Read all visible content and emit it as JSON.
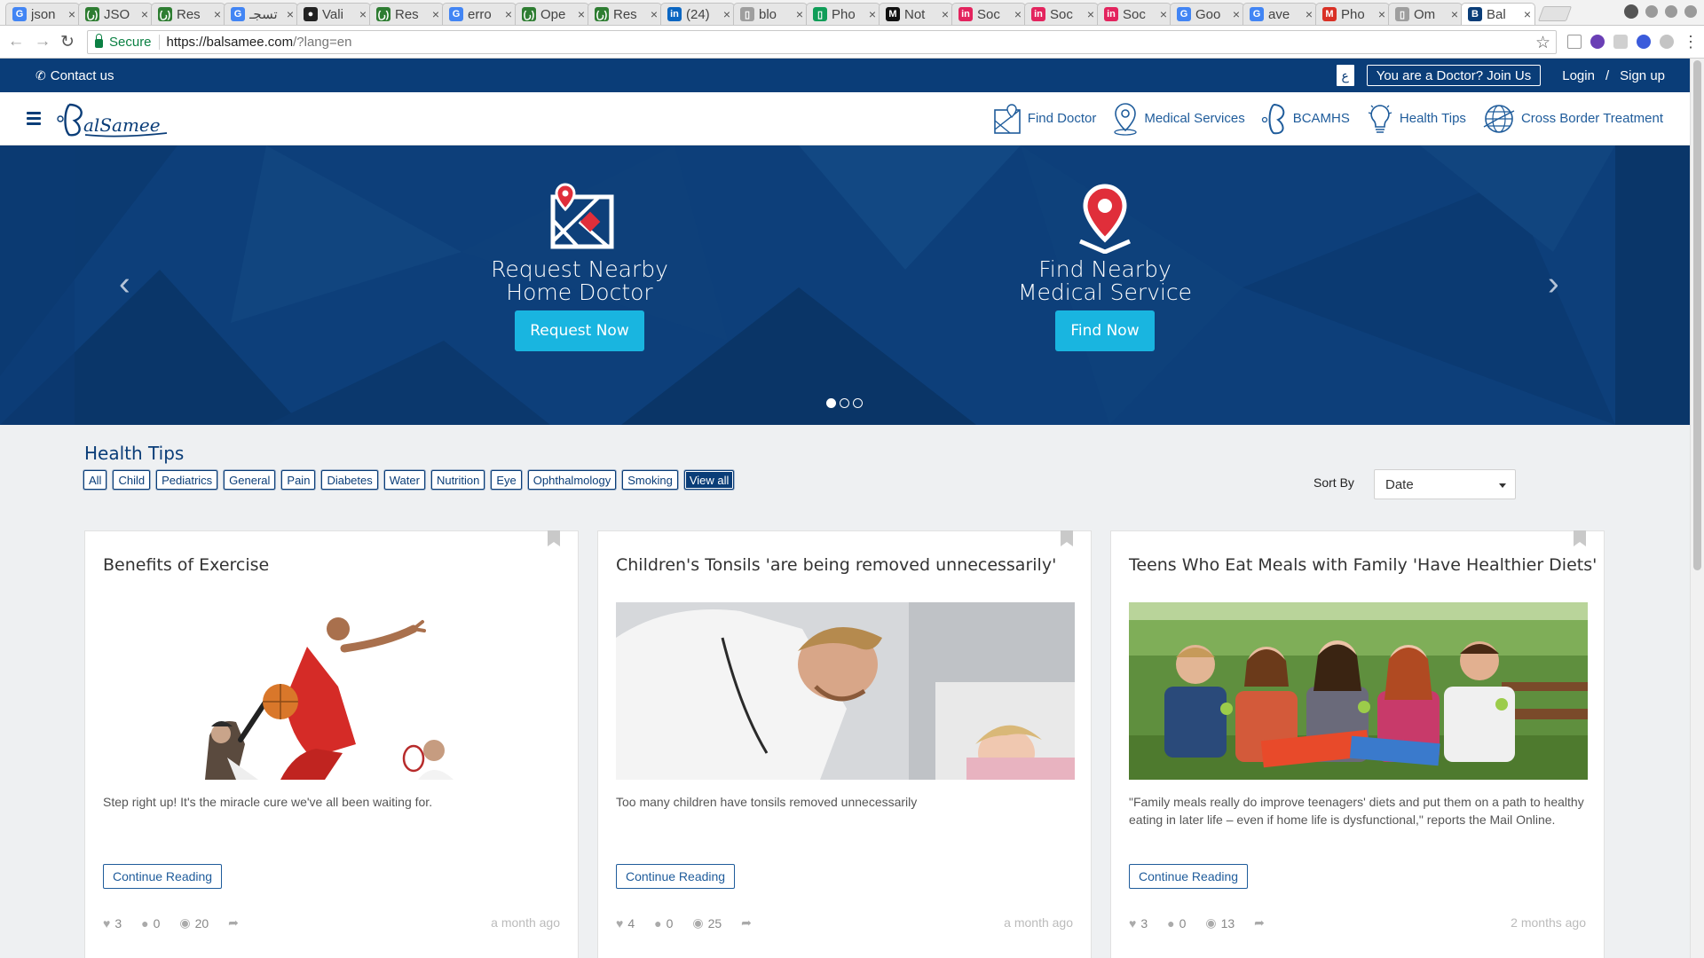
{
  "browser": {
    "tabs": [
      {
        "label": "json",
        "icon": "google-icon",
        "color": "#4285f4",
        "glyph": "G"
      },
      {
        "label": "JSO",
        "icon": "arabic-site-icon",
        "color": "#2e7d32",
        "glyph": "(ر)"
      },
      {
        "label": "Res",
        "icon": "arabic-site-icon",
        "color": "#2e7d32",
        "glyph": "(ر)"
      },
      {
        "label": "تسجـ",
        "icon": "google-icon",
        "color": "#4285f4",
        "glyph": "G"
      },
      {
        "label": "Vali",
        "icon": "github-icon",
        "color": "#222222",
        "glyph": "●"
      },
      {
        "label": "Res",
        "icon": "arabic-site-icon",
        "color": "#2e7d32",
        "glyph": "(ر)"
      },
      {
        "label": "erro",
        "icon": "google-icon",
        "color": "#4285f4",
        "glyph": "G"
      },
      {
        "label": "Ope",
        "icon": "arabic-site-icon",
        "color": "#2e7d32",
        "glyph": "(ر)"
      },
      {
        "label": "Res",
        "icon": "arabic-site-icon",
        "color": "#2e7d32",
        "glyph": "(ر)"
      },
      {
        "label": "(24)",
        "icon": "linkedin-icon",
        "color": "#0a66c2",
        "glyph": "in"
      },
      {
        "label": "blo",
        "icon": "document-icon",
        "color": "#9e9e9e",
        "glyph": "▯"
      },
      {
        "label": "Pho",
        "icon": "sheet-icon",
        "color": "#0f9d58",
        "glyph": "▯"
      },
      {
        "label": "Not",
        "icon": "medium-icon",
        "color": "#111111",
        "glyph": "M"
      },
      {
        "label": "Soc",
        "icon": "invision-icon",
        "color": "#e3245e",
        "glyph": "in"
      },
      {
        "label": "Soc",
        "icon": "invision-icon",
        "color": "#e3245e",
        "glyph": "in"
      },
      {
        "label": "Soc",
        "icon": "invision-icon",
        "color": "#e3245e",
        "glyph": "in"
      },
      {
        "label": "Goo",
        "icon": "translate-icon",
        "color": "#4285f4",
        "glyph": "G"
      },
      {
        "label": "ave",
        "icon": "google-icon",
        "color": "#4285f4",
        "glyph": "G"
      },
      {
        "label": "Pho",
        "icon": "gmail-icon",
        "color": "#d93025",
        "glyph": "M"
      },
      {
        "label": "Om",
        "icon": "document-icon",
        "color": "#9e9e9e",
        "glyph": "▯"
      },
      {
        "label": "Bal",
        "icon": "balsamee-icon",
        "color": "#0a3d78",
        "glyph": "B",
        "active": true
      }
    ],
    "secure_label": "Secure",
    "url_host": "https://balsamee.com",
    "url_rest": "/?lang=en"
  },
  "topbar": {
    "contact": "Contact us",
    "arabic": "ع",
    "join": "You are a Doctor? Join Us",
    "login": "Login",
    "slash": "/",
    "signup": "Sign up"
  },
  "nav": {
    "items": [
      {
        "label": "Find Doctor",
        "icon": "map-doctor-icon"
      },
      {
        "label": "Medical Services",
        "icon": "location-pin-icon"
      },
      {
        "label": "BCAMHS",
        "icon": "balsamee-b-icon"
      },
      {
        "label": "Health Tips",
        "icon": "lightbulb-icon"
      },
      {
        "label": "Cross Border Treatment",
        "icon": "globe-icon"
      }
    ]
  },
  "hero": {
    "slides": [
      {
        "line1": "Request Nearby",
        "line2": "Home Doctor",
        "button": "Request Now",
        "icon": "map-pin-doctor-icon"
      },
      {
        "line1": "Find Nearby",
        "line2": "Medical Service",
        "button": "Find Now",
        "icon": "location-pin-icon"
      }
    ],
    "active_dot": 0,
    "dot_count": 3
  },
  "health_tips": {
    "title": "Health Tips",
    "filters": [
      "All",
      "Child",
      "Pediatrics",
      "General",
      "Pain",
      "Diabetes",
      "Water",
      "Nutrition",
      "Eye",
      "Ophthalmology",
      "Smoking",
      "View all"
    ],
    "sort_label": "Sort By",
    "sort_value": "Date",
    "cards": [
      {
        "title": "Benefits of Exercise",
        "description": "Step right up! It's the miracle cure we've all been waiting for.",
        "button": "Continue Reading",
        "likes": "3",
        "comments": "0",
        "views": "20",
        "ago": "a month ago"
      },
      {
        "title": "Children's Tonsils 'are being removed unnecessarily'",
        "description": "Too many children have tonsils removed unnecessarily",
        "button": "Continue Reading",
        "likes": "4",
        "comments": "0",
        "views": "25",
        "ago": "a month ago"
      },
      {
        "title": "Teens Who Eat Meals with Family 'Have Healthier Diets'",
        "description": "\"Family meals really do improve teenagers' diets and put them on a path to healthy eating in later life – even if home life is dysfunctional,\" reports the Mail Online.",
        "button": "Continue Reading",
        "likes": "3",
        "comments": "0",
        "views": "13",
        "ago": "2 months ago"
      }
    ]
  },
  "colors": {
    "brand": "#0a3d78",
    "accent": "#19b5e0",
    "link": "#1f5c9b"
  }
}
